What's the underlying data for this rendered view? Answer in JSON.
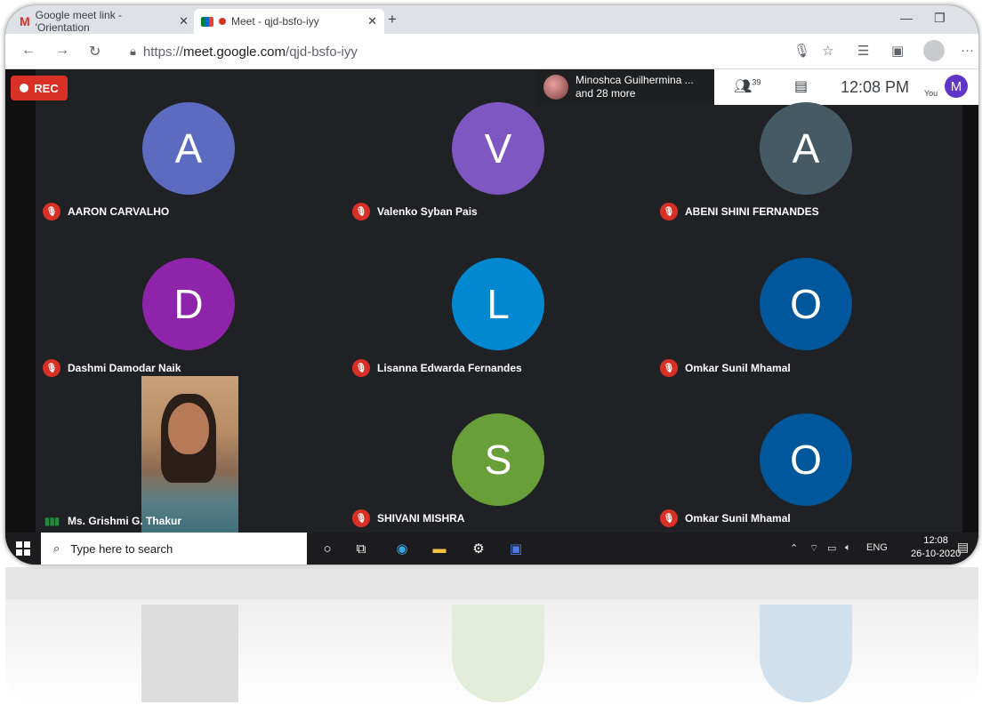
{
  "browser": {
    "tabs": [
      {
        "title": "Google meet link - 'Orientation",
        "active": false
      },
      {
        "title": "Meet - qjd-bsfo-iyy",
        "active": true
      }
    ],
    "url_scheme": "https://",
    "url_host": "meet.google.com",
    "url_path": "/qjd-bsfo-iyy",
    "more_label": "···"
  },
  "meet": {
    "rec_label": "REC",
    "presenter_name": "Minoshca Guilhermina ...",
    "presenter_more": "and 28 more",
    "people_count": "39",
    "time": "12:08 PM",
    "you_label": "You",
    "self_avatar_letter": "M",
    "tiles": [
      {
        "letter": "A",
        "name": "AARON CARVALHO",
        "color": "#5c6bc0"
      },
      {
        "letter": "V",
        "name": "Valenko Syban Pais",
        "color": "#7e57c2"
      },
      {
        "letter": "A",
        "name": "ABENI SHINI FERNANDES",
        "color": "#455a64"
      },
      {
        "letter": "D",
        "name": "Dashmi Damodar Naik",
        "color": "#8e24aa"
      },
      {
        "letter": "L",
        "name": "Lisanna Edwarda Fernandes",
        "color": "#0288d1"
      },
      {
        "letter": "O",
        "name": "Omkar Sunil Mhamal",
        "color": "#01579b"
      },
      {
        "letter": "",
        "name": "Ms. Grishmi G. Thakur",
        "color": "#202124"
      },
      {
        "letter": "S",
        "name": "SHIVANI MISHRA",
        "color": "#689f38"
      },
      {
        "letter": "O",
        "name": "Omkar Sunil Mhamal",
        "color": "#01579b"
      }
    ]
  },
  "taskbar": {
    "search_placeholder": "Type here to search",
    "lang": "ENG",
    "clock_time": "12:08",
    "clock_date": "26-10-2020"
  }
}
